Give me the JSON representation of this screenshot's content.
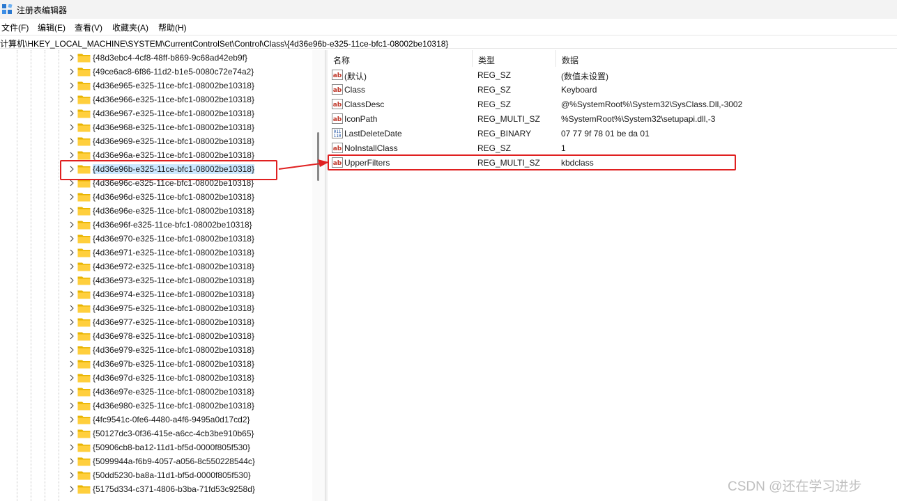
{
  "window": {
    "title": "注册表编辑器",
    "icon": "registry-editor-icon"
  },
  "menu": [
    "文件(F)",
    "编辑(E)",
    "查看(V)",
    "收藏夹(A)",
    "帮助(H)"
  ],
  "address": "计算机\\HKEY_LOCAL_MACHINE\\SYSTEM\\CurrentControlSet\\Control\\Class\\{4d36e96b-e325-11ce-bfc1-08002be10318}",
  "tree": {
    "items": [
      "{48d3ebc4-4cf8-48ff-b869-9c68ad42eb9f}",
      "{49ce6ac8-6f86-11d2-b1e5-0080c72e74a2}",
      "{4d36e965-e325-11ce-bfc1-08002be10318}",
      "{4d36e966-e325-11ce-bfc1-08002be10318}",
      "{4d36e967-e325-11ce-bfc1-08002be10318}",
      "{4d36e968-e325-11ce-bfc1-08002be10318}",
      "{4d36e969-e325-11ce-bfc1-08002be10318}",
      "{4d36e96a-e325-11ce-bfc1-08002be10318}",
      "{4d36e96b-e325-11ce-bfc1-08002be10318}",
      "{4d36e96c-e325-11ce-bfc1-08002be10318}",
      "{4d36e96d-e325-11ce-bfc1-08002be10318}",
      "{4d36e96e-e325-11ce-bfc1-08002be10318}",
      "{4d36e96f-e325-11ce-bfc1-08002be10318}",
      "{4d36e970-e325-11ce-bfc1-08002be10318}",
      "{4d36e971-e325-11ce-bfc1-08002be10318}",
      "{4d36e972-e325-11ce-bfc1-08002be10318}",
      "{4d36e973-e325-11ce-bfc1-08002be10318}",
      "{4d36e974-e325-11ce-bfc1-08002be10318}",
      "{4d36e975-e325-11ce-bfc1-08002be10318}",
      "{4d36e977-e325-11ce-bfc1-08002be10318}",
      "{4d36e978-e325-11ce-bfc1-08002be10318}",
      "{4d36e979-e325-11ce-bfc1-08002be10318}",
      "{4d36e97b-e325-11ce-bfc1-08002be10318}",
      "{4d36e97d-e325-11ce-bfc1-08002be10318}",
      "{4d36e97e-e325-11ce-bfc1-08002be10318}",
      "{4d36e980-e325-11ce-bfc1-08002be10318}",
      "{4fc9541c-0fe6-4480-a4f6-9495a0d17cd2}",
      "{50127dc3-0f36-415e-a6cc-4cb3be910b65}",
      "{50906cb8-ba12-11d1-bf5d-0000f805f530}",
      "{5099944a-f6b9-4057-a056-8c550228544c}",
      "{50dd5230-ba8a-11d1-bf5d-0000f805f530}",
      "{5175d334-c371-4806-b3ba-71fd53c9258d}"
    ],
    "selected_index": 8
  },
  "list": {
    "columns": [
      "名称",
      "类型",
      "数据"
    ],
    "rows": [
      {
        "name": "(默认)",
        "type": "REG_SZ",
        "data": "(数值未设置)",
        "icon": "string-value-icon"
      },
      {
        "name": "Class",
        "type": "REG_SZ",
        "data": "Keyboard",
        "icon": "string-value-icon"
      },
      {
        "name": "ClassDesc",
        "type": "REG_SZ",
        "data": "@%SystemRoot%\\System32\\SysClass.Dll,-3002",
        "icon": "string-value-icon"
      },
      {
        "name": "IconPath",
        "type": "REG_MULTI_SZ",
        "data": "%SystemRoot%\\System32\\setupapi.dll,-3",
        "icon": "string-value-icon"
      },
      {
        "name": "LastDeleteDate",
        "type": "REG_BINARY",
        "data": "07 77 9f 78 01 be da 01",
        "icon": "binary-value-icon"
      },
      {
        "name": "NoInstallClass",
        "type": "REG_SZ",
        "data": "1",
        "icon": "string-value-icon"
      },
      {
        "name": "UpperFilters",
        "type": "REG_MULTI_SZ",
        "data": "kbdclass",
        "icon": "string-value-icon"
      }
    ],
    "highlighted_index": 6
  },
  "annotation": {
    "color": "#e02020"
  },
  "watermark": "CSDN @还在学习进步"
}
